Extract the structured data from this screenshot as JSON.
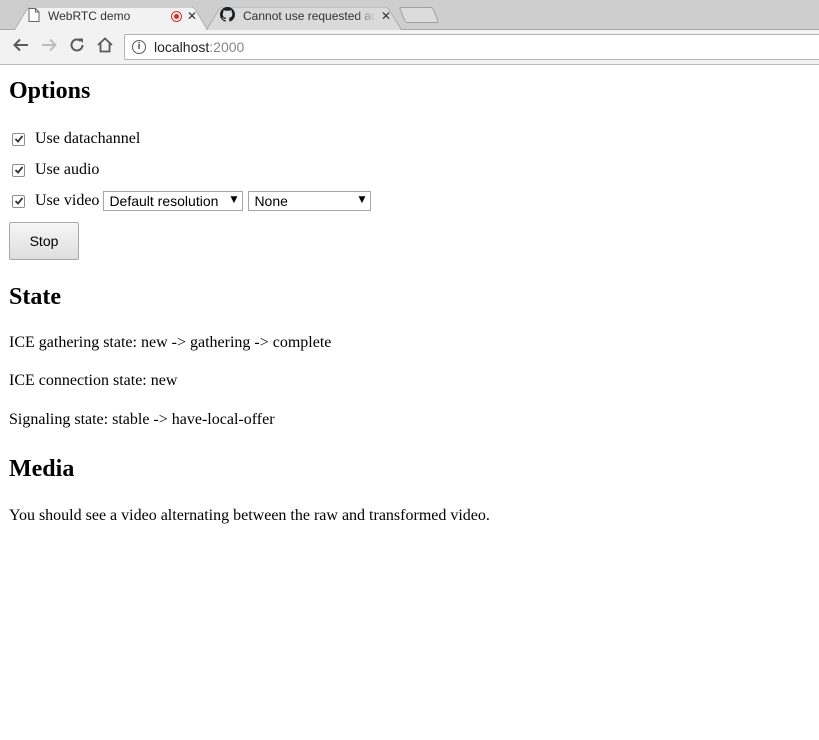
{
  "browser": {
    "tabs": [
      {
        "title": "WebRTC demo",
        "active": true,
        "recording": true
      },
      {
        "title": "Cannot use requested ad",
        "active": false
      }
    ],
    "close_glyph": "✕",
    "url": {
      "host": "localhost",
      "port": ":2000"
    },
    "icons": {
      "back": "back-arrow-icon",
      "forward": "forward-arrow-icon",
      "reload": "reload-icon",
      "home": "home-icon",
      "info": "info-icon",
      "page": "page-icon",
      "github": "github-icon",
      "recording": "recording-icon"
    }
  },
  "options": {
    "heading": "Options",
    "datachannel": {
      "label": "Use datachannel",
      "checked": true
    },
    "audio": {
      "label": "Use audio",
      "checked": true
    },
    "video": {
      "label": "Use video",
      "checked": true
    },
    "resolution_select": {
      "value": "Default resolution"
    },
    "transform_select": {
      "value": "None"
    },
    "stop_button": "Stop"
  },
  "state": {
    "heading": "State",
    "ice_gathering": "ICE gathering state: new -> gathering -> complete",
    "ice_connection": "ICE connection state: new",
    "signaling": "Signaling state: stable -> have-local-offer"
  },
  "media": {
    "heading": "Media",
    "description": "You should see a video alternating between the raw and transformed video."
  },
  "colors": {
    "recording": "#d43030",
    "tabstrip": "#cecece",
    "toolbar": "#f2f2f2"
  }
}
